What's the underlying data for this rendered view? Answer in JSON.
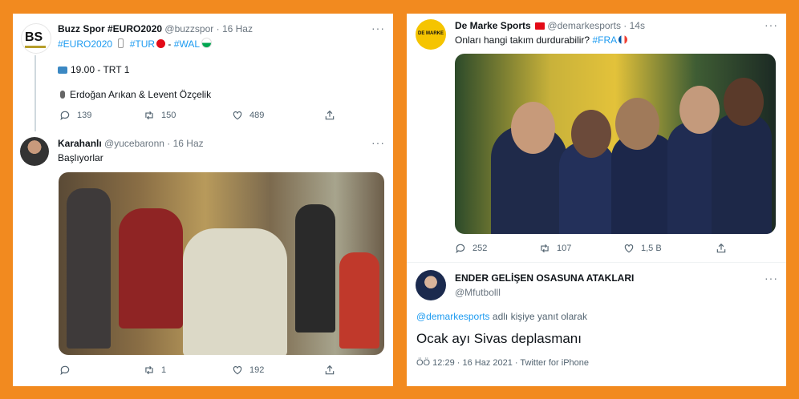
{
  "left": {
    "tweet1": {
      "name": "Buzz Spor #EURO2020",
      "handle": "@buzzspor",
      "date": "· 16 Haz",
      "tags_line": [
        "#EURO2020",
        "#TUR",
        "-",
        "#WAL"
      ],
      "line_tv": "19.00 - TRT 1",
      "line_mic": "Erdoğan Arıkan & Levent Özçelik",
      "replies": "139",
      "retweets": "150",
      "likes": "489",
      "avatar_text": "BS"
    },
    "tweet2": {
      "name": "Karahanlı",
      "handle": "@yucebaronn",
      "date": "· 16 Haz",
      "text": "Başlıyorlar",
      "replies": "",
      "retweets": "1",
      "likes": "192"
    }
  },
  "right": {
    "tweet1": {
      "name": "De Marke Sports",
      "handle": "@demarkesports",
      "date": "· 14s",
      "text": "Onları hangi takım durdurabilir?",
      "tag": "#FRA",
      "replies": "252",
      "retweets": "107",
      "likes": "1,5 B",
      "avatar_text": "DE MARKE"
    },
    "tweet2": {
      "name": "ENDER GELİŞEN OSASUNA ATAKLARI",
      "handle": "@Mfutbolll",
      "reply_prefix_link": "@demarkesports",
      "reply_suffix": "adlı kişiye yanıt olarak",
      "text": "Ocak ayı Sivas deplasmanı",
      "meta": "ÖÖ 12:29 · 16 Haz 2021 · Twitter for iPhone"
    }
  },
  "colors": {
    "accent": "#1d9bf0",
    "frame": "#f28a1f"
  }
}
